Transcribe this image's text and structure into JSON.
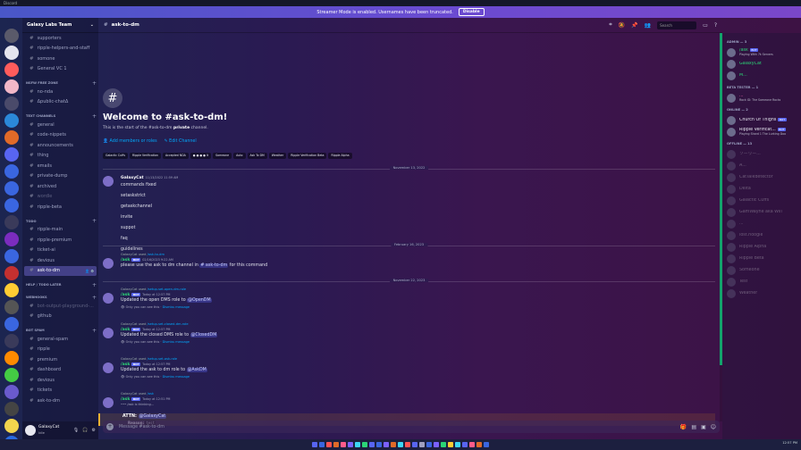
{
  "window": {
    "title": "Discord"
  },
  "streamer": {
    "text": "Streamer Mode is enabled. Usernames have been truncated.",
    "button": "Disable"
  },
  "guild": {
    "name": "Galaxy Labs Team"
  },
  "servers": [
    "#5a5a6a",
    "#e5e5ee",
    "#ff5c5c",
    "#f2b7c8",
    "#4a4a6a",
    "#2b88d9",
    "#e06a28",
    "#5865f2",
    "#3a66e0",
    "#3a66e0",
    "#3a66e0",
    "#3a3a5a",
    "#7b2cbf",
    "#3a66e0",
    "#c43030",
    "#ffcc33",
    "#555",
    "#3a66e0",
    "#3a3a5a",
    "#ff8a00",
    "#4c4",
    "#6a5acd",
    "#444",
    "#f2d44d",
    "#2a6ae0",
    "#c43030"
  ],
  "sidebar": {
    "items": [
      {
        "type": "ch",
        "name": "supporters"
      },
      {
        "type": "ch",
        "name": "ripple-helpers-and-staff"
      },
      {
        "type": "ch",
        "name": "somone"
      },
      {
        "type": "ch",
        "name": "General VC 1"
      },
      {
        "type": "cat",
        "name": "NSFW FREE ZONE"
      },
      {
        "type": "ch",
        "name": "no-nda"
      },
      {
        "type": "ch",
        "name": "Δpublic-chatΔ"
      },
      {
        "type": "cat",
        "name": "TEXT CHANNELS"
      },
      {
        "type": "ch",
        "name": "general"
      },
      {
        "type": "ch",
        "name": "code-nippets"
      },
      {
        "type": "ch",
        "name": "announcements"
      },
      {
        "type": "ch",
        "name": "thing"
      },
      {
        "type": "ch",
        "name": "emails"
      },
      {
        "type": "ch",
        "name": "private-dump"
      },
      {
        "type": "ch",
        "name": "archived"
      },
      {
        "type": "ch",
        "name": "wordle",
        "muted": true
      },
      {
        "type": "ch",
        "name": "ripple-beta"
      },
      {
        "type": "cat",
        "name": "TODO"
      },
      {
        "type": "ch",
        "name": "ripple-main"
      },
      {
        "type": "ch",
        "name": "ripple-premium"
      },
      {
        "type": "ch",
        "name": "ticket-ai"
      },
      {
        "type": "ch",
        "name": "devious"
      },
      {
        "type": "ch",
        "name": "ask-to-dm",
        "active": true
      },
      {
        "type": "cat",
        "name": "HELP / TODO LATER"
      },
      {
        "type": "cat",
        "name": "WEBHOOKS"
      },
      {
        "type": "ch",
        "name": "bot-output-playground-...",
        "muted": true
      },
      {
        "type": "ch",
        "name": "github"
      },
      {
        "type": "cat",
        "name": "BOT SPAM"
      },
      {
        "type": "ch",
        "name": "general-spam"
      },
      {
        "type": "ch",
        "name": "ripple"
      },
      {
        "type": "ch",
        "name": "premium"
      },
      {
        "type": "ch",
        "name": "dashboard"
      },
      {
        "type": "ch",
        "name": "devious"
      },
      {
        "type": "ch",
        "name": "tickets"
      },
      {
        "type": "ch",
        "name": "ask-to-dm"
      }
    ]
  },
  "user": {
    "name": "GalaxyCat",
    "status": "Idle"
  },
  "channel": {
    "name": "ask-to-dm",
    "search_placeholder": "Search"
  },
  "welcome": {
    "icon": "#",
    "title": "Welcome to #ask-to-dm!",
    "sub_pre": "This is the start of the #ask-to-dm ",
    "sub_bold": "private",
    "sub_post": " channel.",
    "add_members": "Add members or roles",
    "edit_channel": "Edit Channel"
  },
  "tags": [
    "Galactic Cuffs",
    "Ripple Verification",
    "Accepted NDA",
    "● ● ● ● lt",
    "Someone",
    "Auto",
    "Ask To DM",
    "Weather",
    "Ripple Verification Beta",
    "Ripple Alpha"
  ],
  "dividers": [
    "November 13, 2022",
    "February 16, 2023",
    "November 22, 2023"
  ],
  "messages": {
    "m1": {
      "author": "GalaxyCat",
      "time": "11/13/2022 11:59 AM",
      "lines": [
        "commands fixed",
        "setaskstrict",
        "getaskchannel",
        "invite",
        "suppot",
        "faq",
        "guidelines"
      ]
    },
    "m2": {
      "reply_user": "GalaxyCat",
      "reply_used": "used",
      "reply_cmd": "/ask-to-dm",
      "author": "/ask",
      "bot": "BOT",
      "time": "02/16/2023 9:22 AM",
      "pre": "please use the ask to dm channel in ",
      "chan": "# ask-to-dm",
      "post": " for this command"
    },
    "m3": {
      "reply_user": "GalaxyCat",
      "reply_used": "used",
      "reply_cmd": "/setup-set-open-dm-role",
      "author": "/ask",
      "bot": "BOT",
      "time": "Today at 12:57 PM",
      "pre": "Updated the open DMS role to ",
      "mention": "@OpenDM",
      "eph": "Only you can see this · ",
      "dismiss": "Dismiss message"
    },
    "m4": {
      "reply_user": "GalaxyCat",
      "reply_used": "used",
      "reply_cmd": "/setup-set-closed-dm-role",
      "author": "/ask",
      "bot": "BOT",
      "time": "Today at 12:57 PM",
      "pre": "Updated the closed DMS role to ",
      "mention": "@ClosedDM",
      "eph": "Only you can see this · ",
      "dismiss": "Dismiss message"
    },
    "m5": {
      "reply_user": "GalaxyCat",
      "reply_used": "used",
      "reply_cmd": "/setup-set-ask-role",
      "author": "/ask",
      "bot": "BOT",
      "time": "Today at 12:57 PM",
      "pre": "Updated the ask to dm role to ",
      "mention": "@AskDM",
      "eph": "Only you can see this · ",
      "dismiss": "Dismiss message"
    },
    "m6": {
      "reply_user": "GalaxyCat",
      "reply_used": "used",
      "reply_cmd": "/ask",
      "author": "/ask",
      "bot": "BOT",
      "time": "Today at 12:51 PM",
      "thinking": "••• /ask is thinking...",
      "attn": "ATTN: ",
      "mention": "@GalaxyCat",
      "reason_label": "Reason:",
      "reason_value": "test"
    }
  },
  "composer": {
    "placeholder": "Message #ask-to-dm"
  },
  "members": [
    {
      "cat": "ADMIN — 3"
    },
    {
      "name": "/ask",
      "bot": "BOT",
      "status": "Playing With 7k Servers",
      "color": "#2bd676"
    },
    {
      "name": "GalaxyCat",
      "color": "#2bd676"
    },
    {
      "name": "M...",
      "color": "#2bd676"
    },
    {
      "cat": "BETA TESTER — 1"
    },
    {
      "name": "...",
      "status": "Rock ID: The Someone Rocks",
      "color": "#ff6ab0"
    },
    {
      "cat": "ONLINE — 2"
    },
    {
      "name": "Church Of Thighs",
      "bot": "BOT",
      "color": "#e6e6f0"
    },
    {
      "name": "Ripple Verificat...",
      "bot": "BOT",
      "status": "Playing Shard 1 The Lurking Doo",
      "color": "#e6e6f0"
    },
    {
      "cat": "OFFLINE — 13"
    },
    {
      "name": "ソーリー...",
      "off": true
    },
    {
      "name": "A...",
      "off": true
    },
    {
      "name": "CatTalkdetector",
      "off": true
    },
    {
      "name": "Delta",
      "off": true
    },
    {
      "name": "Galactic Cuffs",
      "off": true
    },
    {
      "name": "GamWayne aka Will",
      "off": true
    },
    {
      "name": "...",
      "off": true
    },
    {
      "name": "lost.noogle",
      "off": true
    },
    {
      "name": "Ripple Alpha",
      "off": true
    },
    {
      "name": "Ripple Beta",
      "off": true
    },
    {
      "name": "Someone",
      "off": true
    },
    {
      "name": "Test",
      "off": true
    },
    {
      "name": "Weather",
      "off": true
    }
  ],
  "taskbar": {
    "colors": [
      "#5865f2",
      "#3a66e0",
      "#ff5252",
      "#e06a28",
      "#ff5c8a",
      "#7b61ff",
      "#3dd6f5",
      "#2bd676",
      "#5865f2",
      "#3a66e0",
      "#7b61ff",
      "#e06a28",
      "#3dd6f5",
      "#ff5252",
      "#5865f2",
      "#a0a0c0",
      "#3a66e0",
      "#7b61ff",
      "#2bd676",
      "#ffcc33",
      "#3dd6f5",
      "#5865f2",
      "#ff5c8a",
      "#e06a28",
      "#3a66e0"
    ],
    "clock": "12:57 PM"
  }
}
